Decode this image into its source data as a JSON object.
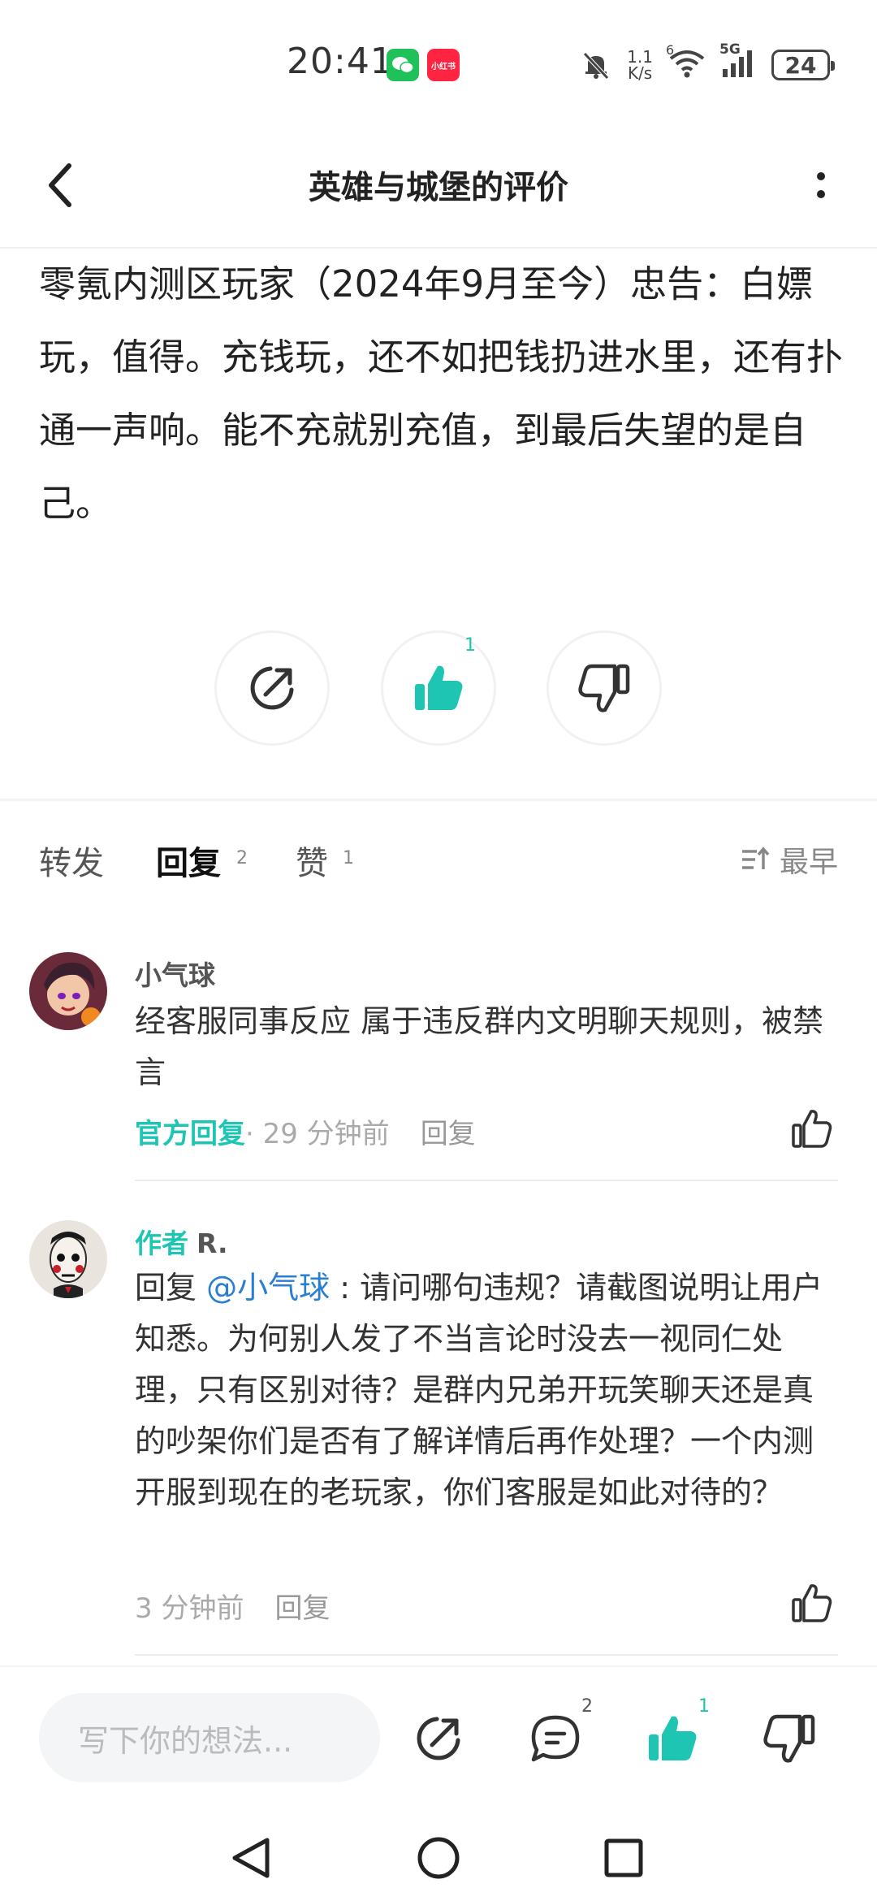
{
  "status_bar": {
    "time": "20:41",
    "xhs_label": "小红书",
    "speed_top": "1.1",
    "speed_bottom": "K/s",
    "wifi_badge": "6",
    "signal_label": "5G",
    "battery": "24",
    "icons": [
      "wechat-icon",
      "xiaohongshu-icon",
      "bell-muted-icon",
      "wifi-icon",
      "signal-icon",
      "battery-icon"
    ]
  },
  "header": {
    "title": "英雄与城堡的评价",
    "back_icon": "chevron-left-icon",
    "more_icon": "more-vertical-icon"
  },
  "review": {
    "text": "零氪内测区玩家（2024年9月至今）忠告：白嫖玩，值得。充钱玩，还不如把钱扔进水里，还有扑通一声响。能不充就别充值，到最后失望的是自己。"
  },
  "actions": {
    "like_count": "1",
    "accent_color": "#1ec5b2"
  },
  "tabs": {
    "forward": "转发",
    "reply": "回复",
    "reply_count": "2",
    "likes": "赞",
    "likes_count": "1",
    "sort": "最早"
  },
  "comments": [
    {
      "name": "小气球",
      "text": "经客服同事反应 属于违反群内文明聊天规则，被禁言",
      "badge": "官方回复",
      "time": " · 29 分钟前",
      "reply": "回复"
    },
    {
      "author_tag": "作者",
      "name": "R.",
      "reply_prefix": "回复 ",
      "mention": "@小气球",
      "text": " : 请问哪句违规？请截图说明让用户知悉。为何别人发了不当言论时没去一视同仁处理，只有区别对待？是群内兄弟开玩笑聊天还是真的吵架你们是否有了解详情后再作处理？一个内测开服到现在的老玩家，你们客服是如此对待的？",
      "time": "3 分钟前",
      "reply": "回复"
    }
  ],
  "bottom_bar": {
    "placeholder": "写下你的想法...",
    "comment_count": "2",
    "like_count": "1"
  }
}
